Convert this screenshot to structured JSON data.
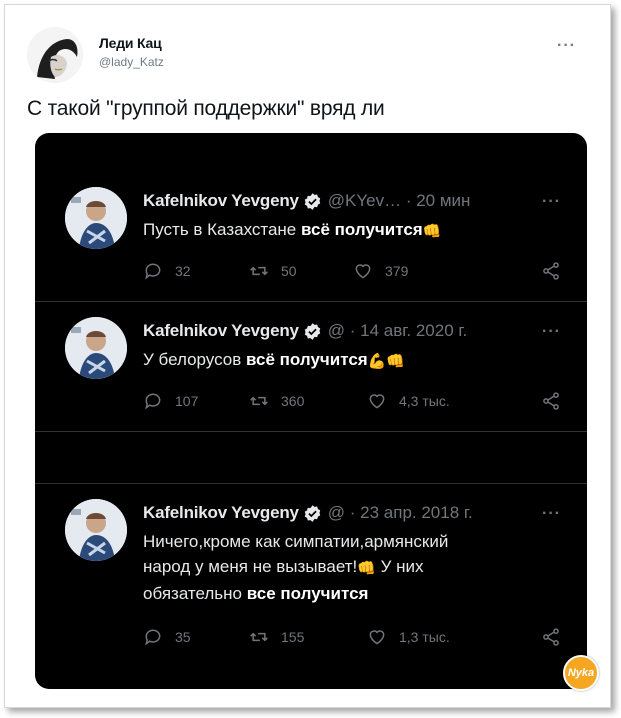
{
  "post": {
    "author_name": "Леди Кац",
    "author_handle": "@lady_Katz",
    "text": "С такой \"группой поддержки\" вряд ли",
    "more_icon": "more-horizontal-icon"
  },
  "colors": {
    "dark_bg": "#000000",
    "dark_text": "#e7e9ea",
    "dark_muted": "#71767b",
    "verified": "#1d9bf0",
    "watermark": "#f5a623"
  },
  "tweets": [
    {
      "name": "Kafelnikov Yevgeny",
      "meta": "@KYev… · 20 мин",
      "text_plain": "Пусть в Казахстане ",
      "text_bold": "всё получится",
      "emoji": "👊",
      "replies": "32",
      "retweets": "50",
      "likes": "379"
    },
    {
      "name": "Kafelnikov Yevgeny",
      "meta": "@ · 14 авг. 2020 г.",
      "text_plain": "У белорусов ",
      "text_bold": "всё получится",
      "emoji": "💪👊",
      "replies": "107",
      "retweets": "360",
      "likes": "4,3 тыс."
    },
    {
      "name": "Kafelnikov Yevgeny",
      "meta": "@ · 23 апр. 2018 г.",
      "line1": "Ничего,кроме как симпатии,армянский",
      "line2": "народ у меня не вызывает!",
      "line2_emoji": "👊",
      "line2_tail": " У них",
      "line3_plain": "обязательно ",
      "line3_bold": "все получится",
      "replies": "35",
      "retweets": "155",
      "likes": "1,3 тыс."
    }
  ],
  "watermark": "Nyka"
}
